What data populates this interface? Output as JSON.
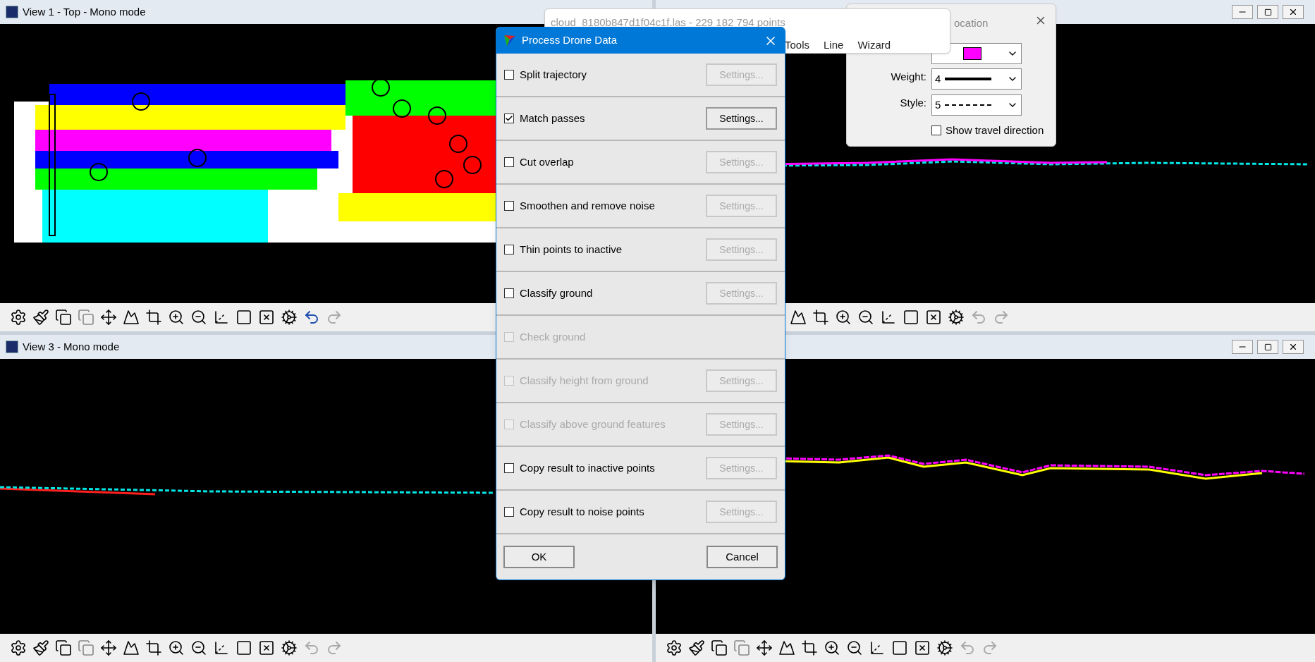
{
  "views": [
    {
      "title": "View 1 - Top - Mono mode",
      "kind": "plan",
      "undo_enabled": true,
      "redo_enabled": false
    },
    {
      "kind": "profile-a",
      "undo_enabled": false,
      "redo_enabled": false
    },
    {
      "title": "View 3 - Mono mode",
      "kind": "profile-b",
      "undo_enabled": false,
      "redo_enabled": false
    },
    {
      "kind": "profile-c",
      "undo_enabled": false,
      "redo_enabled": false
    }
  ],
  "cloud_window": {
    "title": "cloud_8180b847d1f04c1f.las - 229 182 794 points",
    "menu": [
      "Tools",
      "Line",
      "Wizard"
    ]
  },
  "line_popup": {
    "title": "ocation",
    "color": "#ff00ff",
    "weight_label": "Weight:",
    "weight": "4",
    "style_label": "Style:",
    "style": "5",
    "travel": {
      "label": "Show travel direction",
      "checked": false
    }
  },
  "dialog": {
    "title": "Process Drone Data",
    "rows": [
      {
        "label": "Split trajectory",
        "checked": false,
        "disabled": false,
        "settings": "Settings...",
        "settings_enabled": false
      },
      {
        "label": "Match passes",
        "checked": true,
        "disabled": false,
        "settings": "Settings...",
        "settings_enabled": true
      },
      {
        "label": "Cut overlap",
        "checked": false,
        "disabled": false,
        "settings": "Settings...",
        "settings_enabled": false
      },
      {
        "label": "Smoothen and remove noise",
        "checked": false,
        "disabled": false,
        "settings": "Settings...",
        "settings_enabled": false
      },
      {
        "label": "Thin points to inactive",
        "checked": false,
        "disabled": false,
        "settings": "Settings...",
        "settings_enabled": false
      },
      {
        "label": "Classify ground",
        "checked": false,
        "disabled": false,
        "settings": "Settings...",
        "settings_enabled": false
      },
      {
        "label": "Check ground",
        "checked": false,
        "disabled": true
      },
      {
        "label": "Classify height from ground",
        "checked": false,
        "disabled": true,
        "settings": "Settings...",
        "settings_enabled": false
      },
      {
        "label": "Classify above ground features",
        "checked": false,
        "disabled": true,
        "settings": "Settings...",
        "settings_enabled": false
      },
      {
        "label": "Copy result to inactive points",
        "checked": false,
        "disabled": false,
        "settings": "Settings...",
        "settings_enabled": false
      },
      {
        "label": "Copy result to noise points",
        "checked": false,
        "disabled": false,
        "settings": "Settings...",
        "settings_enabled": false
      }
    ],
    "buttons": [
      "OK",
      "Cancel"
    ]
  }
}
